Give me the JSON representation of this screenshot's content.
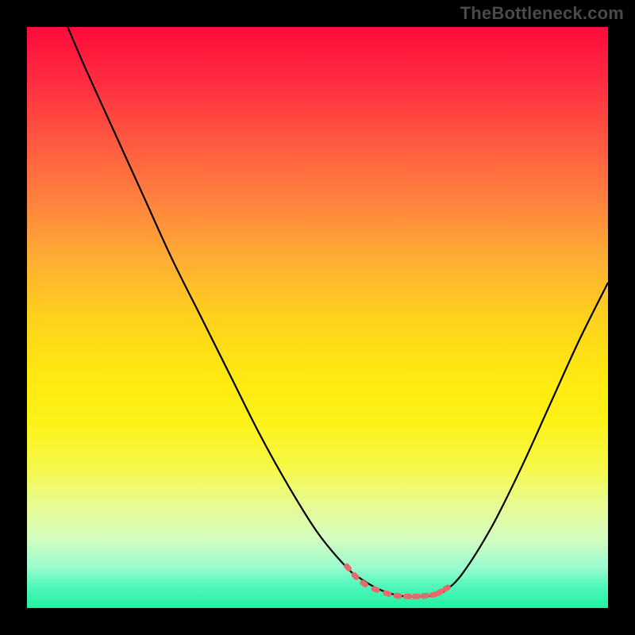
{
  "watermark": "TheBottleneck.com",
  "colors": {
    "frame_bg": "#000000",
    "watermark_text": "#4a4a4a",
    "curve_stroke": "#000000",
    "marker_fill": "#e56a6c",
    "marker_stroke": "#e56a6c"
  },
  "chart_data": {
    "type": "line",
    "title": "",
    "xlabel": "",
    "ylabel": "",
    "xlim": [
      0,
      100
    ],
    "ylim": [
      0,
      100
    ],
    "series": [
      {
        "name": "bottleneck-curve",
        "x": [
          7,
          10,
          15,
          20,
          25,
          30,
          35,
          40,
          45,
          50,
          55,
          57.5,
          60,
          62.5,
          65,
          67.5,
          70,
          72,
          75,
          80,
          85,
          90,
          95,
          100
        ],
        "y": [
          100,
          93,
          82,
          71,
          60,
          50,
          40,
          30,
          21,
          13,
          7,
          5,
          3.5,
          2.5,
          2,
          2,
          2.2,
          3,
          6,
          14,
          24,
          35,
          46,
          56
        ]
      }
    ],
    "markers": {
      "name": "highlight-minimum",
      "x_range": [
        55,
        72
      ],
      "points": [
        {
          "x": 55.2,
          "y": 7.0
        },
        {
          "x": 56.5,
          "y": 5.5
        },
        {
          "x": 58.0,
          "y": 4.2
        },
        {
          "x": 60.0,
          "y": 3.2
        },
        {
          "x": 62.0,
          "y": 2.5
        },
        {
          "x": 63.8,
          "y": 2.1
        },
        {
          "x": 65.5,
          "y": 2.0
        },
        {
          "x": 67.0,
          "y": 2.0
        },
        {
          "x": 68.5,
          "y": 2.1
        },
        {
          "x": 70.0,
          "y": 2.3
        },
        {
          "x": 71.0,
          "y": 2.7
        },
        {
          "x": 72.2,
          "y": 3.4
        }
      ]
    },
    "vertical_y_is_inverted_note": "y represents percent bottleneck; 0 is at bottom, 100 at top"
  }
}
